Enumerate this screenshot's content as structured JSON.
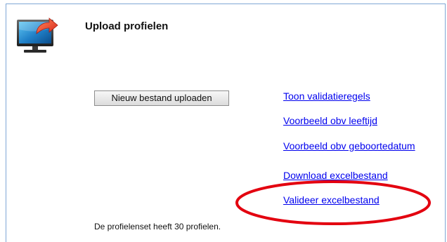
{
  "page": {
    "title": "Upload profielen",
    "icon": "monitor-upload-icon"
  },
  "actions": {
    "upload_button_label": "Nieuw bestand uploaden"
  },
  "links": [
    {
      "label": "Toon validatieregels"
    },
    {
      "label": "Voorbeeld obv leeftijd"
    },
    {
      "label": "Voorbeeld obv geboortedatum"
    },
    {
      "label": "Download excelbestand"
    },
    {
      "label": "Valideer excelbestand"
    }
  ],
  "status": {
    "profile_count_text": "De profielenset heeft 30 profielen."
  },
  "colors": {
    "link": "#0000ee",
    "panel_border": "#7fa7d6",
    "annotation": "#e3000f"
  }
}
